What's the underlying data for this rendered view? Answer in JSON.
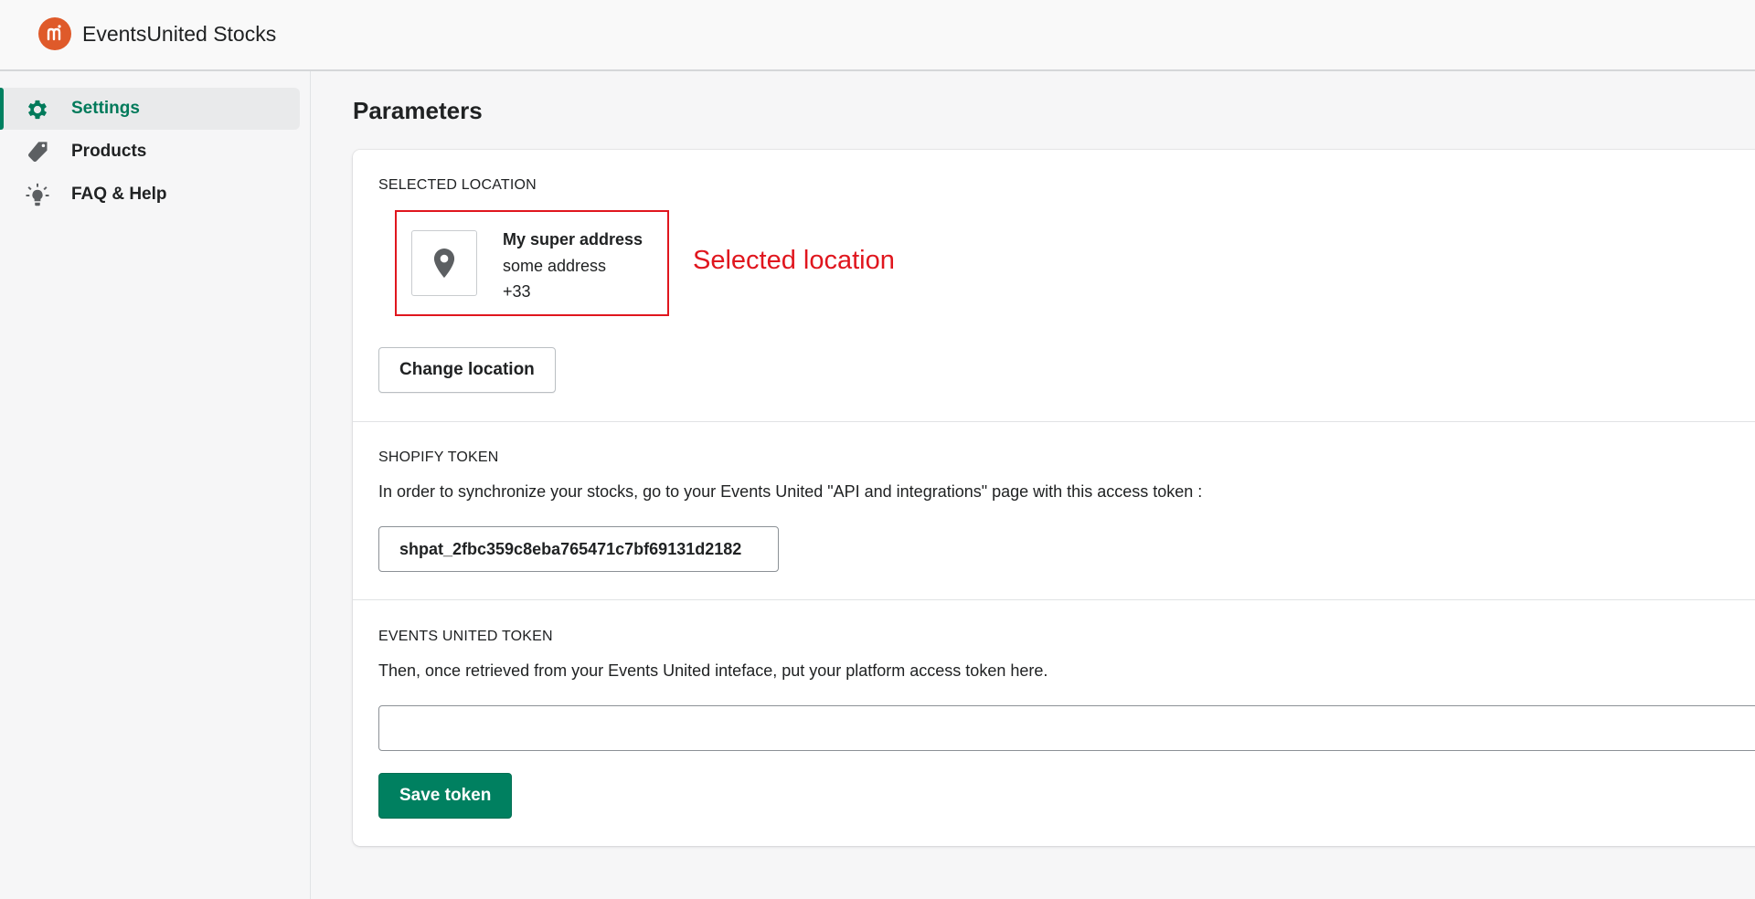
{
  "app": {
    "title": "EventsUnited Stocks",
    "logo_glyph": "m",
    "logo_color": "#df5a2a"
  },
  "sidebar": {
    "items": [
      {
        "label": "Settings",
        "icon": "gear-icon",
        "active": true
      },
      {
        "label": "Products",
        "icon": "tag-icon",
        "active": false
      },
      {
        "label": "FAQ & Help",
        "icon": "lightbulb-icon",
        "active": false
      }
    ]
  },
  "page": {
    "title": "Parameters"
  },
  "location_section": {
    "heading": "SELECTED LOCATION",
    "name": "My super address",
    "address": "some address",
    "phone": "+33",
    "annotation": "Selected location",
    "change_button": "Change location"
  },
  "shopify_section": {
    "heading": "SHOPIFY TOKEN",
    "helper": "In order to synchronize your stocks, go to your Events United \"API and integrations\" page with this access token :",
    "token": "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"
  },
  "events_section": {
    "heading": "EVENTS UNITED TOKEN",
    "helper": "Then, once retrieved from your Events United inteface, put your platform access token here.",
    "input_value": "",
    "save_button": "Save token"
  },
  "colors": {
    "accent": "#008060",
    "annotation": "#e0161e"
  }
}
